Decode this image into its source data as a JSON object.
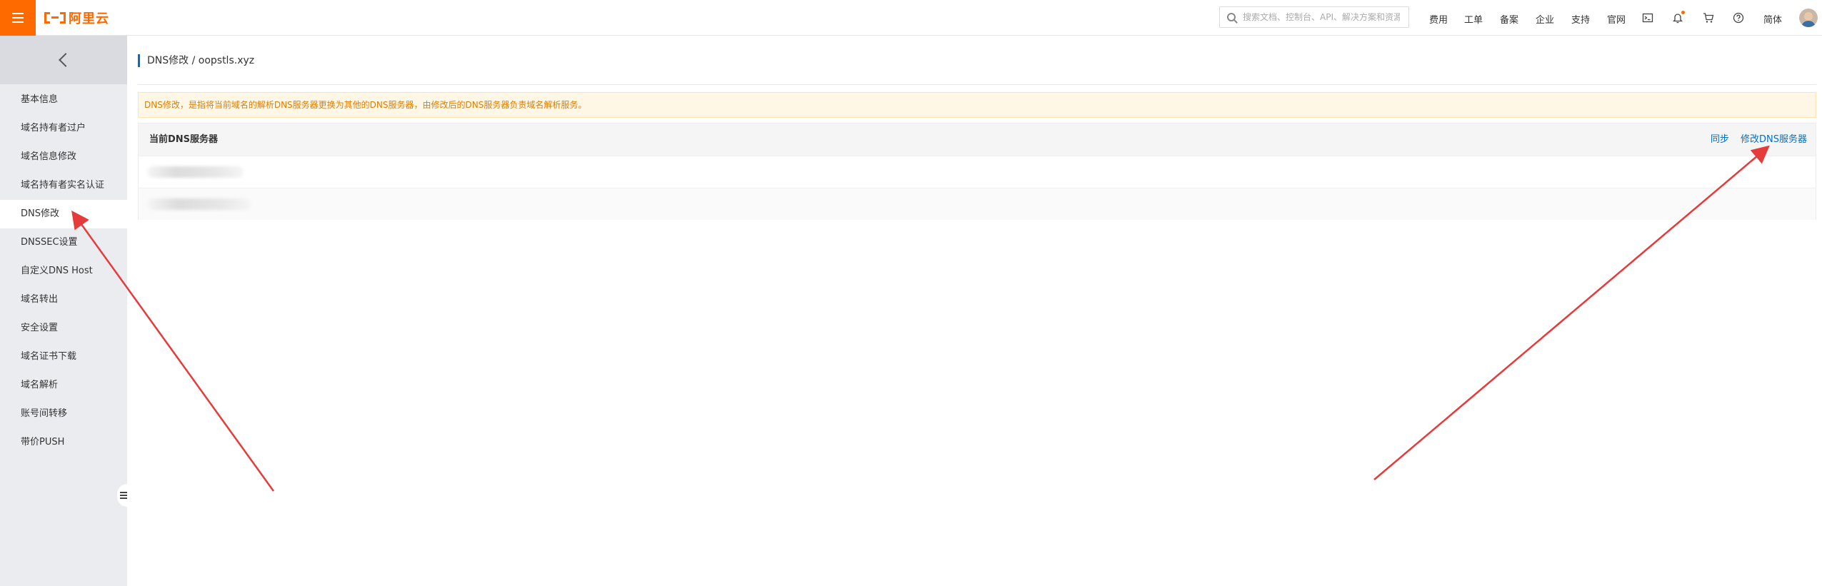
{
  "topbar": {
    "logo_text": "阿里云",
    "search_placeholder": "搜索文档、控制台、API、解决方案和资源",
    "nav": [
      "费用",
      "工单",
      "备案",
      "企业",
      "支持",
      "官网"
    ],
    "lang": "简体",
    "icons": [
      "terminal-icon",
      "bell-icon",
      "cart-icon",
      "help-icon"
    ],
    "accent": "#ff6a00"
  },
  "sidebar": {
    "items": [
      {
        "label": "基本信息"
      },
      {
        "label": "域名持有者过户"
      },
      {
        "label": "域名信息修改"
      },
      {
        "label": "域名持有者实名认证"
      },
      {
        "label": "DNS修改",
        "active": true
      },
      {
        "label": "DNSSEC设置"
      },
      {
        "label": "自定义DNS Host"
      },
      {
        "label": "域名转出"
      },
      {
        "label": "安全设置"
      },
      {
        "label": "域名证书下载"
      },
      {
        "label": "域名解析"
      },
      {
        "label": "账号间转移"
      },
      {
        "label": "带价PUSH"
      }
    ]
  },
  "main": {
    "breadcrumb": "DNS修改 / oopstls.xyz",
    "notice": "DNS修改，是指将当前域名的解析DNS服务器更换为其他的DNS服务器，由修改后的DNS服务器负责域名解析服务。",
    "panel": {
      "title": "当前DNS服务器",
      "sync_label": "同步",
      "modify_label": "修改DNS服务器"
    }
  },
  "colors": {
    "link": "#0070cc",
    "notice_text": "#e07e00",
    "annotation_arrow": "#e63b3b"
  }
}
